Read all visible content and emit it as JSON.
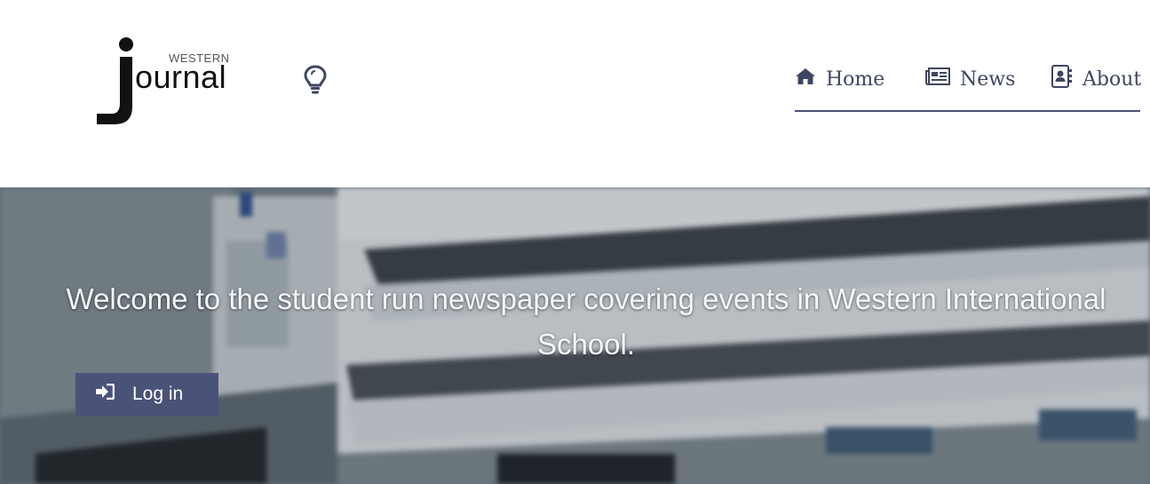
{
  "logo": {
    "small_text": "WESTERN",
    "word_text": "ournal"
  },
  "header_icons": {
    "theme_toggle_icon": "lightbulb-icon"
  },
  "nav": {
    "items": [
      {
        "label": "Home",
        "icon": "home-icon"
      },
      {
        "label": "News",
        "icon": "newspaper-icon"
      },
      {
        "label": "About",
        "icon": "address-book-icon"
      }
    ],
    "accent_color": "#4a5278"
  },
  "hero": {
    "headline": "Welcome to the student run newspaper covering events in Western International School.",
    "login_button": {
      "label": "Log in",
      "icon": "sign-in-icon"
    }
  }
}
